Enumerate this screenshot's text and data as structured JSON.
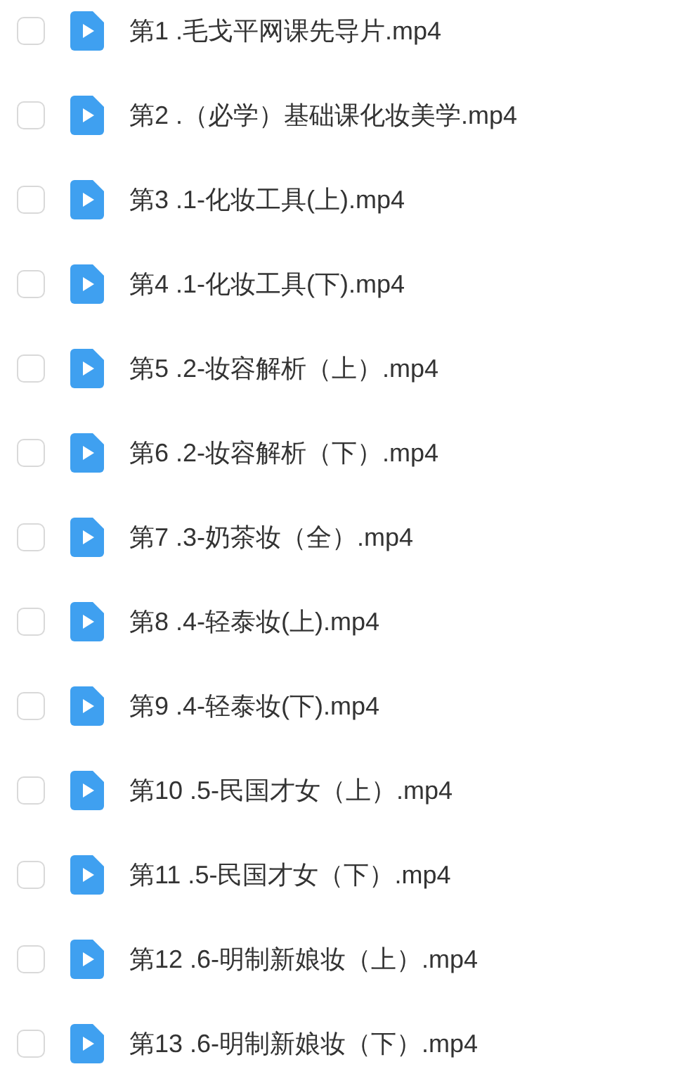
{
  "files": [
    {
      "name": "第1 .毛戈平网课先导片.mp4",
      "checked": false
    },
    {
      "name": "第2 .（必学）基础课化妆美学.mp4",
      "checked": false
    },
    {
      "name": "第3 .1-化妆工具(上).mp4",
      "checked": false
    },
    {
      "name": "第4 .1-化妆工具(下).mp4",
      "checked": false
    },
    {
      "name": "第5 .2-妆容解析（上）.mp4",
      "checked": false
    },
    {
      "name": "第6 .2-妆容解析（下）.mp4",
      "checked": false
    },
    {
      "name": "第7 .3-奶茶妆（全）.mp4",
      "checked": false
    },
    {
      "name": "第8 .4-轻泰妆(上).mp4",
      "checked": false
    },
    {
      "name": "第9 .4-轻泰妆(下).mp4",
      "checked": false
    },
    {
      "name": "第10 .5-民国才女（上）.mp4",
      "checked": false
    },
    {
      "name": "第11 .5-民国才女（下）.mp4",
      "checked": false
    },
    {
      "name": "第12 .6-明制新娘妆（上）.mp4",
      "checked": false
    },
    {
      "name": "第13 .6-明制新娘妆（下）.mp4",
      "checked": false
    }
  ]
}
